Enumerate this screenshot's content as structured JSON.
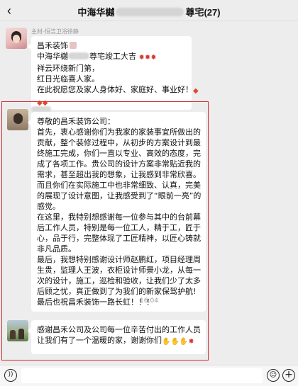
{
  "header": {
    "back_icon": "chevron-left-icon",
    "title_prefix": "中海华樾",
    "title_suffix": "尊宅(27)"
  },
  "messages": [
    {
      "sender": "主材-恒洁卫浴徐静",
      "lines": [
        "昌禾装饰",
        "中海华樾",
        "尊宅竣工大吉",
        "祥云环绕新门第，",
        "红日光临喜人家。",
        "在此祝愿您及家人身体好、家庭好、事业好！"
      ],
      "emojis": [
        "firecracker",
        "firecracker",
        "firecracker",
        "fortune",
        "fortune",
        "fortune"
      ]
    },
    {
      "lines": [
        "尊敬的昌禾装饰公司：",
        "首先，衷心感谢你们为我家的家装事宜所做出的",
        "贡献，整个装修过程中，从初步的方案设计到最",
        "终施工完成，你们一直以专业、高效的态度，完",
        "成了各项工作。贵公司的设计方案非常贴近我的",
        "需求，甚至超出我的想象，让我感到非常欣喜。",
        "而且你们在实际施工中也非常细致、认真，完美",
        "的展现了设计意图，让我感受到了“眼前一亮”的",
        "感觉。",
        "在这里，我特别想感谢每一位参与其中的台前幕",
        "后工作人员，特别是每一位工人，精于工，匠于",
        "心，品于行，完整体现了工匠精神，以匠心铸就",
        "非凡品质。",
        "最后，我想特别感谢设计师赵鹏红，项目经理周",
        "生贵，监理人王波，衣柜设计师景小龙，从每一",
        "次的设计，施工，巡检和验收，让我们少了太多",
        "后顾之忧，真正做到了为我们的新家保驾护航!",
        "最后也祝昌禾装饰一路长虹！！！"
      ]
    },
    {
      "lines": [
        "感谢昌禾公司及公司每一位辛苦付出的工作人员",
        "让我们有了一个温暖的家，谢谢你们"
      ],
      "emojis": [
        "clap",
        "clap",
        "clap",
        "firecracker"
      ]
    }
  ],
  "timestamp": "16:04",
  "bottom_bar": {
    "voice_icon": "voice-icon",
    "emoji_icon": "smile-icon",
    "more_icon": "plus-icon"
  },
  "colors": {
    "highlight": "#d22b36",
    "bubble": "#ffffff",
    "background": "#ededed"
  }
}
